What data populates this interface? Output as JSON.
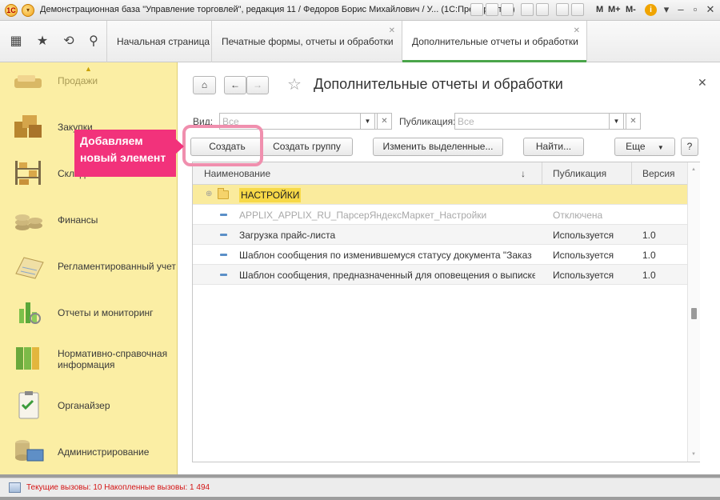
{
  "window": {
    "title": "Демонстрационная база \"Управление торговлей\", редакция 11 / Федоров Борис Михайлович / У... (1С:Предприятие)",
    "toolbar_labels": [
      "M",
      "M+",
      "M-"
    ]
  },
  "nav": {
    "tabs": [
      {
        "label": "Начальная страница"
      },
      {
        "label": "Печатные формы, отчеты и обработки"
      },
      {
        "label": "Дополнительные отчеты и обработки"
      }
    ]
  },
  "sidebar": {
    "items": [
      {
        "label": "Продажи",
        "icon": "sales-icon"
      },
      {
        "label": "Закупки",
        "icon": "purchases-icon"
      },
      {
        "label": "Склад",
        "icon": "warehouse-icon"
      },
      {
        "label": "Финансы",
        "icon": "finance-icon"
      },
      {
        "label": "Регламентированный учет",
        "icon": "regulated-accounting-icon"
      },
      {
        "label": "Отчеты и мониторинг",
        "icon": "reports-monitoring-icon"
      },
      {
        "label": "Нормативно-справочная информация",
        "icon": "reference-info-icon"
      },
      {
        "label": "Органайзер",
        "icon": "organizer-icon"
      },
      {
        "label": "Администрирование",
        "icon": "administration-icon"
      }
    ]
  },
  "page": {
    "title": "Дополнительные отчеты и обработки",
    "filter_view_label": "Вид:",
    "filter_view_placeholder": "Все",
    "filter_publication_label": "Публикация:",
    "filter_publication_placeholder": "Все"
  },
  "buttons": {
    "create": "Создать",
    "create_group": "Создать группу",
    "edit_selected": "Изменить выделенные...",
    "find": "Найти...",
    "more": "Еще",
    "help": "?"
  },
  "callout": {
    "line1": "Добавляем",
    "line2": "новый элемент"
  },
  "table": {
    "columns": {
      "name": "Наименование",
      "publication": "Публикация",
      "version": "Версия",
      "sort_indicator": "↓"
    },
    "group_row": {
      "name": "НАСТРОЙКИ"
    },
    "rows": [
      {
        "name": "APPLIX_APPLIX_RU_ПарсерЯндексМаркет_Настройки",
        "publication": "Отключена",
        "version": ""
      },
      {
        "name": "Загрузка прайс-листа",
        "publication": "Используется",
        "version": "1.0"
      },
      {
        "name": "Шаблон сообщения по изменившемуся статусу документа \"Заказ ...",
        "publication": "Используется",
        "version": "1.0"
      },
      {
        "name": "Шаблон сообщения, предназначенный для оповещения о выписке ...",
        "publication": "Используется",
        "version": "1.0"
      }
    ]
  },
  "status": {
    "text": "Текущие вызовы: 10   Накопленные вызовы: 1 494"
  },
  "colors": {
    "sidebar_bg": "#fbeea4",
    "callout_bg": "#f2327b",
    "group_row_bg": "#faeb9d",
    "active_tab_underline": "#4aa54a",
    "status_text": "#d41616"
  }
}
